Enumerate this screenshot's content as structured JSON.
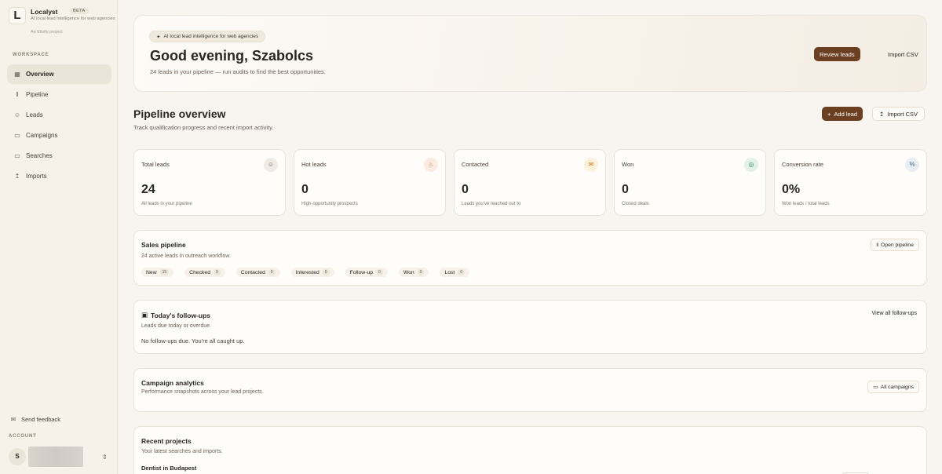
{
  "brand": {
    "logo_letter": "L",
    "name": "Localyst",
    "badge": "BETA",
    "tagline": "AI local lead intelligence for web agencies",
    "sub": "An Elixify project"
  },
  "sidebar": {
    "workspace_label": "WORKSPACE",
    "items": [
      {
        "label": "Overview",
        "icon": "grid-icon",
        "active": true
      },
      {
        "label": "Pipeline",
        "icon": "kanban-icon"
      },
      {
        "label": "Leads",
        "icon": "users-icon"
      },
      {
        "label": "Campaigns",
        "icon": "folder-icon"
      },
      {
        "label": "Searches",
        "icon": "search-folder-icon"
      },
      {
        "label": "Imports",
        "icon": "upload-icon"
      }
    ],
    "feedback_label": "Send feedback",
    "account_label": "ACCOUNT",
    "avatar_letter": "S"
  },
  "hero": {
    "pill": "AI local lead intelligence for web agencies",
    "title": "Good evening, Szabolcs",
    "subtitle": "24 leads in your pipeline — run audits to find the best opportunities.",
    "review_button": "Review leads",
    "import_button": "Import CSV"
  },
  "pipeline": {
    "title": "Pipeline overview",
    "subtitle": "Track qualification progress and recent import activity.",
    "add_button": "Add lead",
    "import_button": "Import CSV"
  },
  "stats": [
    {
      "label": "Total leads",
      "value": "24",
      "caption": "All leads in your pipeline",
      "icon": "users-icon",
      "color": "#6b6056",
      "bg": "#f0ebe4"
    },
    {
      "label": "Hot leads",
      "value": "0",
      "caption": "High-opportunity prospects",
      "icon": "flame-icon",
      "color": "#d06a2c",
      "bg": "#fbece1"
    },
    {
      "label": "Contacted",
      "value": "0",
      "caption": "Leads you've reached out to",
      "icon": "mail-icon",
      "color": "#c6781c",
      "bg": "#fdf1dc"
    },
    {
      "label": "Won",
      "value": "0",
      "caption": "Closed deals",
      "icon": "target-icon",
      "color": "#2f8a55",
      "bg": "#e3f1e8"
    },
    {
      "label": "Conversion rate",
      "value": "0%",
      "caption": "Won leads / total leads",
      "icon": "percent-icon",
      "color": "#4c6a86",
      "bg": "#e8eef4"
    }
  ],
  "sales_pipeline": {
    "title": "Sales pipeline",
    "subtitle": "24 active leads in outreach workflow.",
    "button": "Open pipeline",
    "stages": [
      {
        "label": "New",
        "count": "15"
      },
      {
        "label": "Checked",
        "count": "9"
      },
      {
        "label": "Contacted",
        "count": "0"
      },
      {
        "label": "Interested",
        "count": "0"
      },
      {
        "label": "Follow-up",
        "count": "0"
      },
      {
        "label": "Won",
        "count": "0"
      },
      {
        "label": "Lost",
        "count": "0"
      }
    ]
  },
  "followups": {
    "title": "Today's follow-ups",
    "subtitle": "Leads due today or overdue.",
    "link": "View all follow-ups",
    "empty": "No follow-ups due. You're all caught up."
  },
  "campaign_analytics": {
    "title": "Campaign analytics",
    "subtitle": "Performance snapshots across your lead projects.",
    "button": "All campaigns"
  },
  "recent_projects": {
    "title": "Recent projects",
    "subtitle": "Your latest searches and imports.",
    "items": [
      {
        "name": "Dentist in Budapest"
      }
    ]
  }
}
